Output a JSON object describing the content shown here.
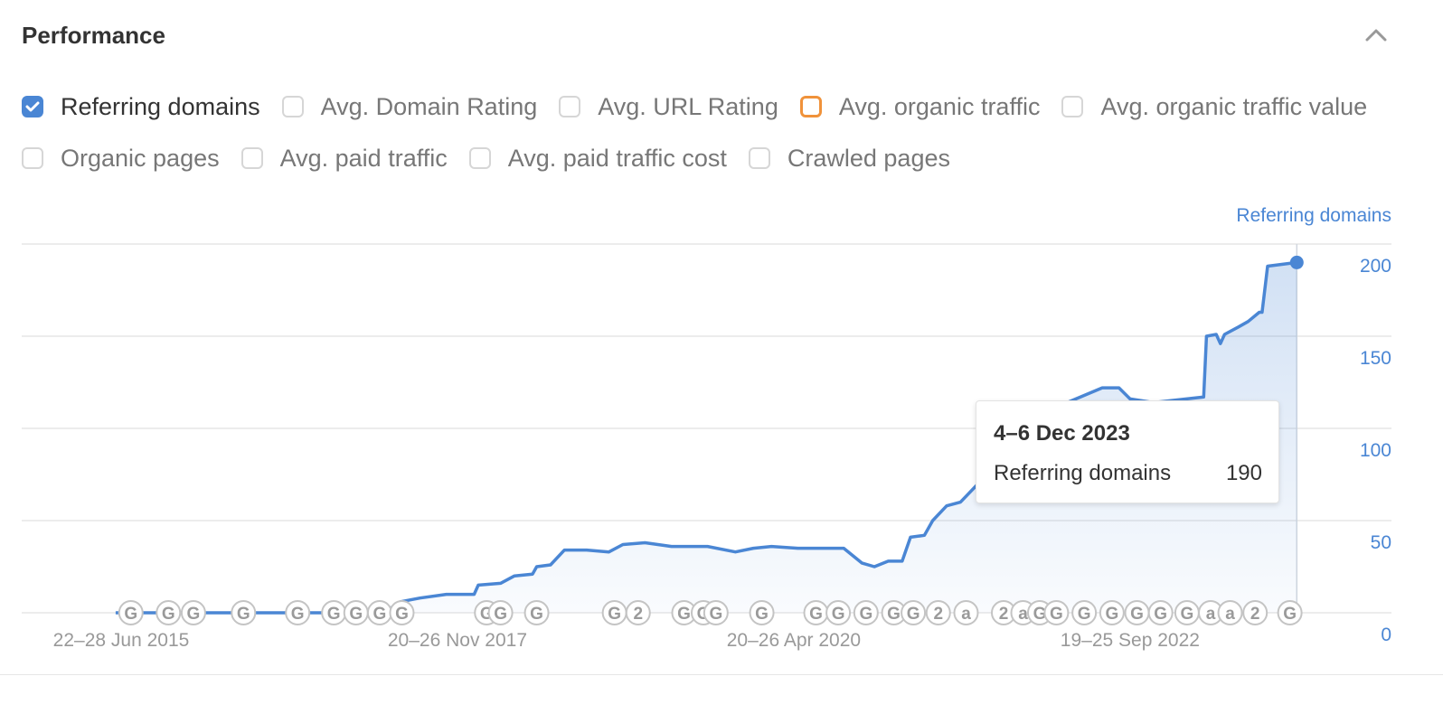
{
  "header": {
    "title": "Performance",
    "collapse_icon": "chevron-up-icon"
  },
  "options": [
    [
      {
        "label": "Referring domains",
        "checked": true,
        "style": "checked"
      },
      {
        "label": "Avg. Domain Rating",
        "checked": false,
        "style": "plain"
      },
      {
        "label": "Avg. URL Rating",
        "checked": false,
        "style": "plain"
      },
      {
        "label": "Avg. organic traffic",
        "checked": false,
        "style": "orange"
      },
      {
        "label": "Avg. organic traffic value",
        "checked": false,
        "style": "plain"
      }
    ],
    [
      {
        "label": "Organic pages",
        "checked": false,
        "style": "plain"
      },
      {
        "label": "Avg. paid traffic",
        "checked": false,
        "style": "plain"
      },
      {
        "label": "Avg. paid traffic cost",
        "checked": false,
        "style": "plain"
      },
      {
        "label": "Crawled pages",
        "checked": false,
        "style": "plain"
      }
    ]
  ],
  "colors": {
    "accent": "#4a86d4",
    "orange": "#f0923a",
    "grid": "#e6e6e6",
    "axis_text": "#999999"
  },
  "tooltip": {
    "date": "4–6 Dec 2023",
    "series": "Referring domains",
    "value": "190"
  },
  "chart_data": {
    "type": "area",
    "title": "",
    "series_label": "Referring domains",
    "xlabel": "",
    "ylabel": "Referring domains",
    "ylim": [
      0,
      200
    ],
    "yticks": [
      "0",
      "50",
      "100",
      "150",
      "200"
    ],
    "ytick_values": [
      0,
      50,
      100,
      150,
      200
    ],
    "y_axis_position": "right",
    "grid": true,
    "xticks": [
      {
        "label": "22–28 Jun 2015",
        "year": 2015.47
      },
      {
        "label": "20–26 Nov 2017",
        "year": 2017.89
      },
      {
        "label": "20–26 Apr 2020",
        "year": 2020.31
      },
      {
        "label": "19–25 Sep 2022",
        "year": 2022.73
      }
    ],
    "xlim_years": [
      2014.78,
      2024.57
    ],
    "series": [
      {
        "name": "Referring domains",
        "points": [
          [
            2015.43,
            0
          ],
          [
            2017.36,
            0
          ],
          [
            2017.48,
            6
          ],
          [
            2017.62,
            8
          ],
          [
            2017.81,
            10
          ],
          [
            2018.01,
            10
          ],
          [
            2018.04,
            15
          ],
          [
            2018.2,
            16
          ],
          [
            2018.3,
            20
          ],
          [
            2018.43,
            21
          ],
          [
            2018.46,
            25
          ],
          [
            2018.56,
            26
          ],
          [
            2018.66,
            34
          ],
          [
            2018.82,
            34
          ],
          [
            2018.98,
            33
          ],
          [
            2019.08,
            37
          ],
          [
            2019.24,
            38
          ],
          [
            2019.43,
            36
          ],
          [
            2019.56,
            36
          ],
          [
            2019.69,
            36
          ],
          [
            2019.89,
            33
          ],
          [
            2020.02,
            35
          ],
          [
            2020.15,
            36
          ],
          [
            2020.34,
            35
          ],
          [
            2020.67,
            35
          ],
          [
            2020.8,
            27
          ],
          [
            2020.89,
            25
          ],
          [
            2020.99,
            28
          ],
          [
            2021.09,
            28
          ],
          [
            2021.15,
            41
          ],
          [
            2021.25,
            42
          ],
          [
            2021.31,
            50
          ],
          [
            2021.41,
            58
          ],
          [
            2021.51,
            60
          ],
          [
            2021.7,
            75
          ],
          [
            2021.95,
            95
          ],
          [
            2022.15,
            110
          ],
          [
            2022.34,
            116
          ],
          [
            2022.53,
            122
          ],
          [
            2022.65,
            122
          ],
          [
            2022.73,
            116
          ],
          [
            2022.9,
            114
          ],
          [
            2023.26,
            117
          ],
          [
            2023.28,
            150
          ],
          [
            2023.35,
            151
          ],
          [
            2023.38,
            146
          ],
          [
            2023.41,
            151
          ],
          [
            2023.51,
            155
          ],
          [
            2023.58,
            158
          ],
          [
            2023.66,
            163
          ],
          [
            2023.68,
            163
          ],
          [
            2023.72,
            188
          ],
          [
            2023.93,
            190
          ]
        ]
      }
    ],
    "annotations": {
      "markers": [
        {
          "year": 2015.54,
          "label": "G"
        },
        {
          "year": 2015.81,
          "label": "G"
        },
        {
          "year": 2015.99,
          "label": "G"
        },
        {
          "year": 2016.35,
          "label": "G"
        },
        {
          "year": 2016.74,
          "label": "G"
        },
        {
          "year": 2017.0,
          "label": "G"
        },
        {
          "year": 2017.16,
          "label": "G"
        },
        {
          "year": 2017.33,
          "label": "G"
        },
        {
          "year": 2017.49,
          "label": "G"
        },
        {
          "year": 2018.1,
          "label": "G"
        },
        {
          "year": 2018.2,
          "label": "G"
        },
        {
          "year": 2018.46,
          "label": "G"
        },
        {
          "year": 2019.02,
          "label": "G"
        },
        {
          "year": 2019.19,
          "label": "2"
        },
        {
          "year": 2019.52,
          "label": "G"
        },
        {
          "year": 2019.66,
          "label": "G"
        },
        {
          "year": 2019.75,
          "label": "G"
        },
        {
          "year": 2020.08,
          "label": "G"
        },
        {
          "year": 2020.47,
          "label": "G"
        },
        {
          "year": 2020.63,
          "label": "G"
        },
        {
          "year": 2020.83,
          "label": "G"
        },
        {
          "year": 2021.03,
          "label": "G"
        },
        {
          "year": 2021.17,
          "label": "G"
        },
        {
          "year": 2021.35,
          "label": "2"
        },
        {
          "year": 2021.55,
          "label": "a"
        },
        {
          "year": 2021.82,
          "label": "2"
        },
        {
          "year": 2021.96,
          "label": "a"
        },
        {
          "year": 2022.08,
          "label": "G"
        },
        {
          "year": 2022.2,
          "label": "G"
        },
        {
          "year": 2022.4,
          "label": "G"
        },
        {
          "year": 2022.6,
          "label": "G"
        },
        {
          "year": 2022.78,
          "label": "G"
        },
        {
          "year": 2022.95,
          "label": "G"
        },
        {
          "year": 2023.14,
          "label": "G"
        },
        {
          "year": 2023.31,
          "label": "a"
        },
        {
          "year": 2023.45,
          "label": "a"
        },
        {
          "year": 2023.63,
          "label": "2"
        },
        {
          "year": 2023.88,
          "label": "G"
        }
      ]
    },
    "hover": {
      "date": "4–6 Dec 2023",
      "value": 190,
      "year": 2023.93
    }
  }
}
